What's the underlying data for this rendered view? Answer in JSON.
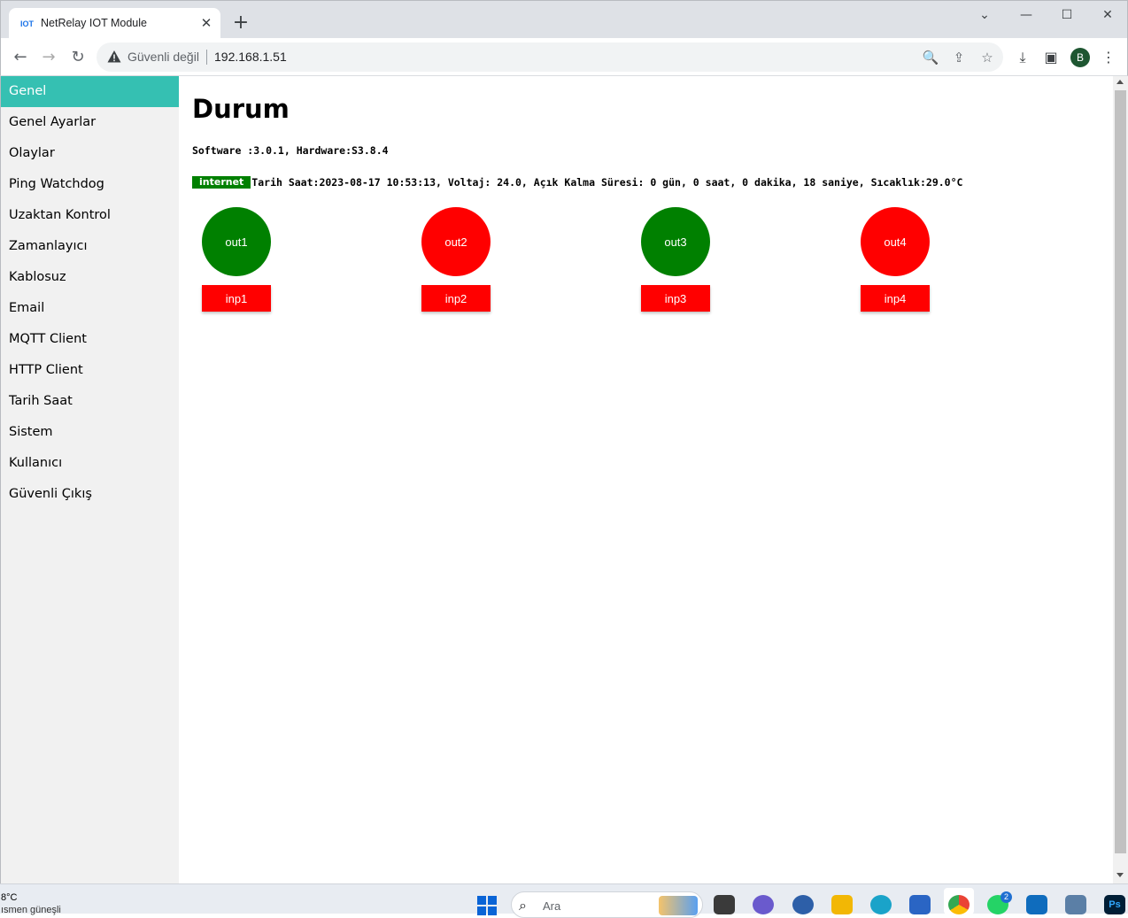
{
  "browser": {
    "tab_favicon_text": "IOT",
    "tab_title": "NetRelay IOT Module",
    "tab_close_glyph": "✕",
    "new_tab_glyph": "+",
    "window_controls": {
      "tabsearch": "⌄",
      "minimize": "—",
      "maximize": "☐",
      "close": "✕"
    },
    "nav": {
      "back": "←",
      "forward": "→",
      "reload": "↻"
    },
    "security_label": "Güvenli değil",
    "url": "192.168.1.51",
    "omnibox_icons": {
      "zoom": "🔍",
      "share": "⇪",
      "bookmark": "☆"
    },
    "toolbar_icons": {
      "download": "⤓",
      "sidepanel": "▣",
      "menu": "⋮"
    },
    "profile_initial": "B"
  },
  "sidebar": {
    "items": [
      {
        "label": "Genel",
        "active": true
      },
      {
        "label": "Genel Ayarlar"
      },
      {
        "label": "Olaylar"
      },
      {
        "label": "Ping Watchdog"
      },
      {
        "label": "Uzaktan Kontrol"
      },
      {
        "label": "Zamanlayıcı"
      },
      {
        "label": "Kablosuz"
      },
      {
        "label": "Email"
      },
      {
        "label": "MQTT Client"
      },
      {
        "label": "HTTP Client"
      },
      {
        "label": "Tarih Saat"
      },
      {
        "label": "Sistem"
      },
      {
        "label": "Kullanıcı"
      },
      {
        "label": "Güvenli Çıkış"
      }
    ]
  },
  "main": {
    "title": "Durum",
    "version_line": "Software :3.0.1, Hardware:S3.8.4",
    "internet_badge": "internet",
    "status_text": "Tarih Saat:2023-08-17 10:53:13, Voltaj: 24.0, Açık Kalma Süresi: 0 gün, 0 saat, 0 dakika, 18 saniye, Sıcaklık:29.0°C",
    "outputs": [
      {
        "label": "out1",
        "state": "on",
        "color": "#008000"
      },
      {
        "label": "out2",
        "state": "off",
        "color": "#ff0000"
      },
      {
        "label": "out3",
        "state": "on",
        "color": "#008000"
      },
      {
        "label": "out4",
        "state": "off",
        "color": "#ff0000"
      }
    ],
    "inputs": [
      {
        "label": "inp1",
        "color": "#ff0000"
      },
      {
        "label": "inp2",
        "color": "#ff0000"
      },
      {
        "label": "inp3",
        "color": "#ff0000"
      },
      {
        "label": "inp4",
        "color": "#ff0000"
      }
    ]
  },
  "taskbar": {
    "weather_temp": "8°C",
    "weather_desc": "ısmen güneşli",
    "search_glyph": "⌕",
    "search_placeholder": "Ara",
    "whatsapp_badge": "2",
    "photoshop_label": "Ps"
  },
  "colors": {
    "sidebar_active": "#35c0b2",
    "relay_on": "#008000",
    "relay_off": "#ff0000",
    "internet_badge": "#008000"
  }
}
